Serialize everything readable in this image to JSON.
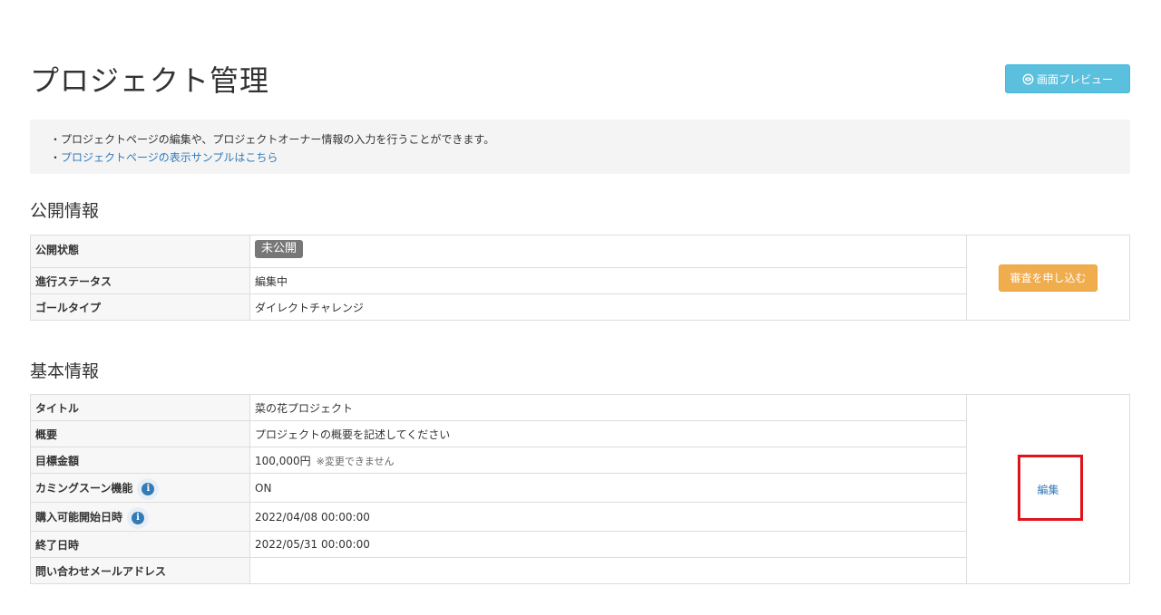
{
  "page": {
    "title": "プロジェクト管理",
    "preview_button": "画面プレビュー"
  },
  "notice": {
    "line1": "・プロジェクトページの編集や、プロジェクトオーナー情報の入力を行うことができます。",
    "line2_prefix": "・",
    "line2_link": "プロジェクトページの表示サンプルはこちら"
  },
  "public_info": {
    "heading": "公開情報",
    "rows": [
      {
        "label": "公開状態",
        "value": "未公開"
      },
      {
        "label": "進行ステータス",
        "value": "編集中"
      },
      {
        "label": "ゴールタイプ",
        "value": "ダイレクトチャレンジ"
      }
    ],
    "apply_button": "審査を申し込む"
  },
  "basic_info": {
    "heading": "基本情報",
    "rows": [
      {
        "label": "タイトル",
        "value": "菜の花プロジェクト"
      },
      {
        "label": "概要",
        "value": "プロジェクトの概要を記述してください"
      },
      {
        "label": "目標金額",
        "value": "100,000円",
        "note": "※変更できません"
      },
      {
        "label": "カミングスーン機能",
        "value": "ON"
      },
      {
        "label": "購入可能開始日時",
        "value": "2022/04/08 00:00:00"
      },
      {
        "label": "終了日時",
        "value": "2022/05/31 00:00:00"
      },
      {
        "label": "問い合わせメールアドレス",
        "value": ""
      }
    ],
    "edit_link": "編集"
  },
  "icons": {
    "preview": "eye-icon",
    "help": "info-icon"
  },
  "colors": {
    "preview_button": "#5bc0de",
    "apply_button": "#f0ad4e",
    "badge": "#777777",
    "link": "#337ab7",
    "highlight": "#e0131b"
  }
}
